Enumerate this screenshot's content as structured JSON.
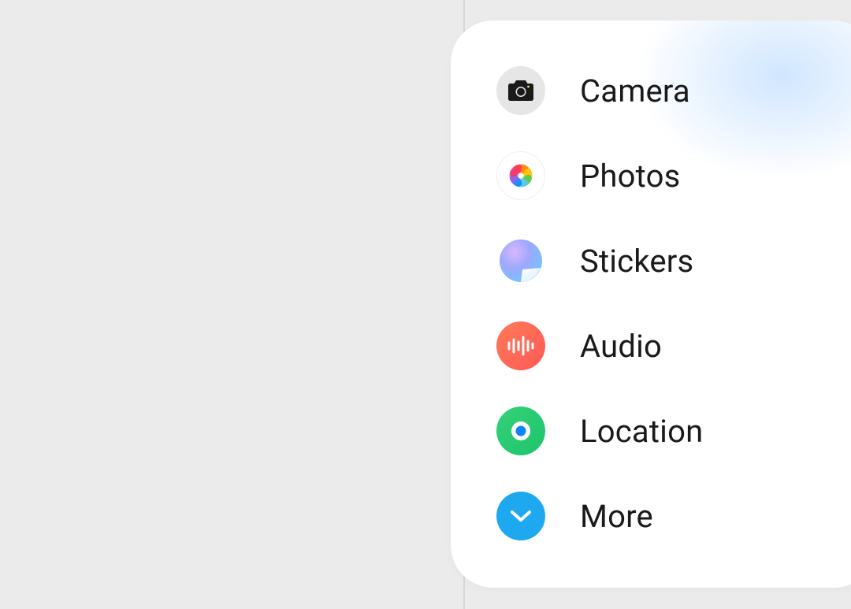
{
  "menu": {
    "items": [
      {
        "label": "Camera"
      },
      {
        "label": "Photos"
      },
      {
        "label": "Stickers"
      },
      {
        "label": "Audio"
      },
      {
        "label": "Location"
      },
      {
        "label": "More"
      }
    ]
  }
}
